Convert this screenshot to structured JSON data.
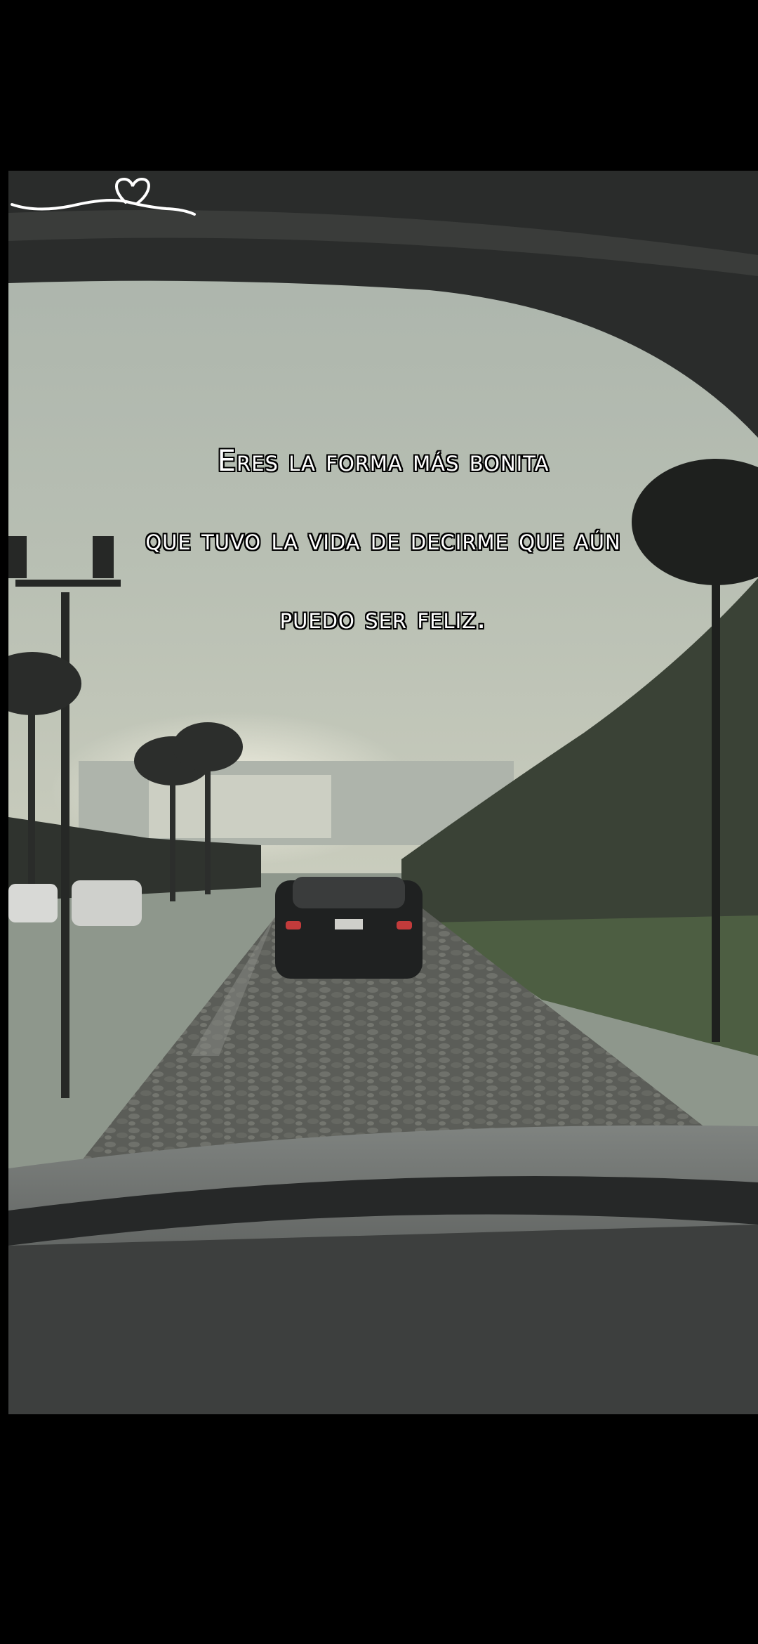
{
  "video_caption": {
    "line_1": "Eres la forma más bonita",
    "line_2": "que tuvo la vida de decirme que aún",
    "line_3": "puedo ser feliz."
  },
  "decoration": {
    "icon": "heart-flourish-icon",
    "color": "#ffffff"
  },
  "colors": {
    "background": "#000000",
    "sky": "#9aa39a",
    "caption_text": "#ffffff",
    "caption_outline": "#000000"
  }
}
